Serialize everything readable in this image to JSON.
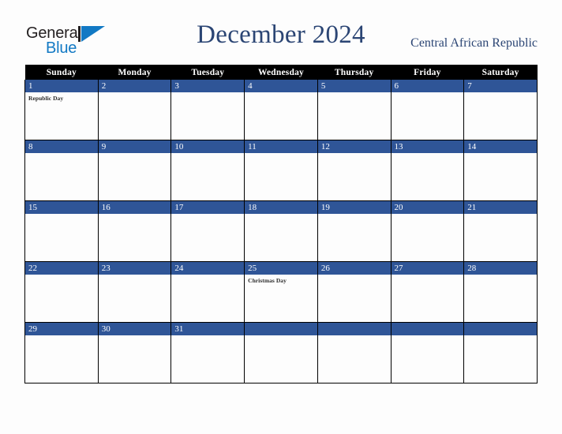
{
  "brand": {
    "name_part1": "General",
    "name_part2": "Blue",
    "logo_icon": "triangle-flag-icon",
    "color_black": "#231f20",
    "color_blue": "#1279c4"
  },
  "header": {
    "month_title": "December 2024",
    "country": "Central African Republic",
    "title_color": "#2b4574"
  },
  "calendar": {
    "accent_color": "#2f5597",
    "header_bg": "#000000",
    "weekday_headers": [
      "Sunday",
      "Monday",
      "Tuesday",
      "Wednesday",
      "Thursday",
      "Friday",
      "Saturday"
    ],
    "weeks": [
      [
        {
          "day": "1",
          "events": [
            "Republic Day"
          ]
        },
        {
          "day": "2",
          "events": []
        },
        {
          "day": "3",
          "events": []
        },
        {
          "day": "4",
          "events": []
        },
        {
          "day": "5",
          "events": []
        },
        {
          "day": "6",
          "events": []
        },
        {
          "day": "7",
          "events": []
        }
      ],
      [
        {
          "day": "8",
          "events": []
        },
        {
          "day": "9",
          "events": []
        },
        {
          "day": "10",
          "events": []
        },
        {
          "day": "11",
          "events": []
        },
        {
          "day": "12",
          "events": []
        },
        {
          "day": "13",
          "events": []
        },
        {
          "day": "14",
          "events": []
        }
      ],
      [
        {
          "day": "15",
          "events": []
        },
        {
          "day": "16",
          "events": []
        },
        {
          "day": "17",
          "events": []
        },
        {
          "day": "18",
          "events": []
        },
        {
          "day": "19",
          "events": []
        },
        {
          "day": "20",
          "events": []
        },
        {
          "day": "21",
          "events": []
        }
      ],
      [
        {
          "day": "22",
          "events": []
        },
        {
          "day": "23",
          "events": []
        },
        {
          "day": "24",
          "events": []
        },
        {
          "day": "25",
          "events": [
            "Christmas Day"
          ]
        },
        {
          "day": "26",
          "events": []
        },
        {
          "day": "27",
          "events": []
        },
        {
          "day": "28",
          "events": []
        }
      ],
      [
        {
          "day": "29",
          "events": []
        },
        {
          "day": "30",
          "events": []
        },
        {
          "day": "31",
          "events": []
        },
        {
          "day": "",
          "events": []
        },
        {
          "day": "",
          "events": []
        },
        {
          "day": "",
          "events": []
        },
        {
          "day": "",
          "events": []
        }
      ]
    ]
  }
}
